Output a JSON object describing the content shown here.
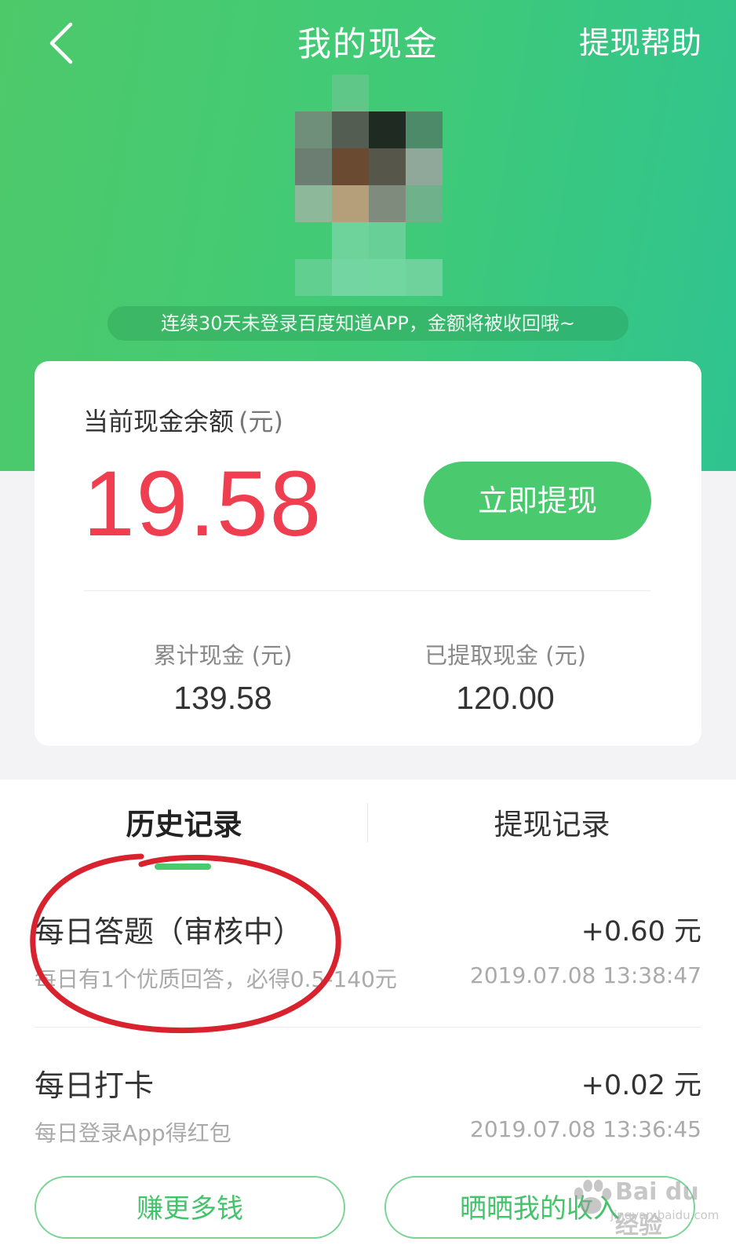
{
  "header": {
    "title": "我的现金",
    "help_label": "提现帮助",
    "notice": "连续30天未登录百度知道APP，金额将被收回哦~"
  },
  "balance": {
    "label": "当前现金余额",
    "unit": "(元)",
    "value": "19.58",
    "withdraw_label": "立即提现"
  },
  "stats": {
    "total_label": "累计现金 (元)",
    "total_value": "139.58",
    "withdrawn_label": "已提取现金 (元)",
    "withdrawn_value": "120.00"
  },
  "tabs": [
    {
      "label": "历史记录",
      "active": true
    },
    {
      "label": "提现记录",
      "active": false
    }
  ],
  "records": [
    {
      "title": "每日答题（审核中）",
      "amount": "+0.60 元",
      "desc": "每日有1个优质回答，必得0.5-140元",
      "time": "2019.07.08 13:38:47"
    },
    {
      "title": "每日打卡",
      "amount": "+0.02 元",
      "desc": "每日登录App得红包",
      "time": "2019.07.08 13:36:45"
    }
  ],
  "bottom": {
    "earn_label": "赚更多钱",
    "share_label": "晒晒我的收入"
  },
  "watermark": {
    "text": "Bai du 经验",
    "url": "jingyan.baidu.com"
  },
  "colors": {
    "brand_green": "#4bc96e",
    "balance_red": "#ef3e4f",
    "annotation_red": "#d8222e"
  }
}
